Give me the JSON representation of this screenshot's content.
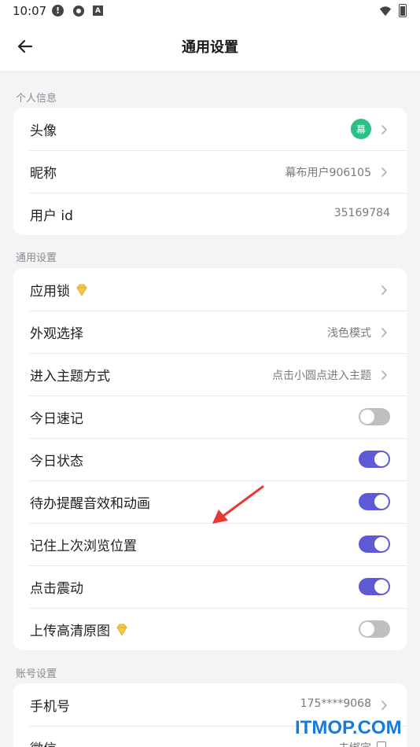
{
  "status_bar": {
    "time": "10:07",
    "icons": [
      "alert-icon",
      "gear-icon",
      "a-icon",
      "wifi-icon",
      "battery-icon"
    ]
  },
  "header": {
    "title": "通用设置"
  },
  "sections": [
    {
      "label": "个人信息",
      "rows": [
        {
          "name": "avatar",
          "label": "头像",
          "avatar_text": "幕",
          "chevron": true
        },
        {
          "name": "nickname",
          "label": "昵称",
          "value": "幕布用户906105",
          "chevron": true
        },
        {
          "name": "user-id",
          "label": "用户 id",
          "value": "35169784",
          "chevron": false
        }
      ]
    },
    {
      "label": "通用设置",
      "rows": [
        {
          "name": "app-lock",
          "label": "应用锁",
          "premium": true,
          "chevron": true
        },
        {
          "name": "appearance",
          "label": "外观选择",
          "value": "浅色模式",
          "chevron": true
        },
        {
          "name": "theme-entry",
          "label": "进入主题方式",
          "value": "点击小圆点进入主题",
          "chevron": true
        },
        {
          "name": "daily-notes",
          "label": "今日速记",
          "toggle": false
        },
        {
          "name": "daily-status",
          "label": "今日状态",
          "toggle": true
        },
        {
          "name": "todo-reminder",
          "label": "待办提醒音效和动画",
          "toggle": true
        },
        {
          "name": "remember-position",
          "label": "记住上次浏览位置",
          "toggle": true
        },
        {
          "name": "tap-vibration",
          "label": "点击震动",
          "toggle": true
        },
        {
          "name": "upload-hd",
          "label": "上传高清原图",
          "premium": true,
          "toggle": false
        }
      ]
    },
    {
      "label": "账号设置",
      "rows": [
        {
          "name": "phone",
          "label": "手机号",
          "value": "175****9068",
          "chevron": true
        },
        {
          "name": "wechat",
          "label": "微信",
          "value": "未绑定",
          "checkbox": true
        }
      ]
    }
  ],
  "watermark": "ITMOP.COM",
  "colors": {
    "accent": "#5e5ad6",
    "toggle_off": "#bfbfbf",
    "avatar_bg": "#2cbf86",
    "premium_gold": "#f3c94a",
    "annotation_red": "#e53935",
    "watermark": "#1a7ad9"
  }
}
